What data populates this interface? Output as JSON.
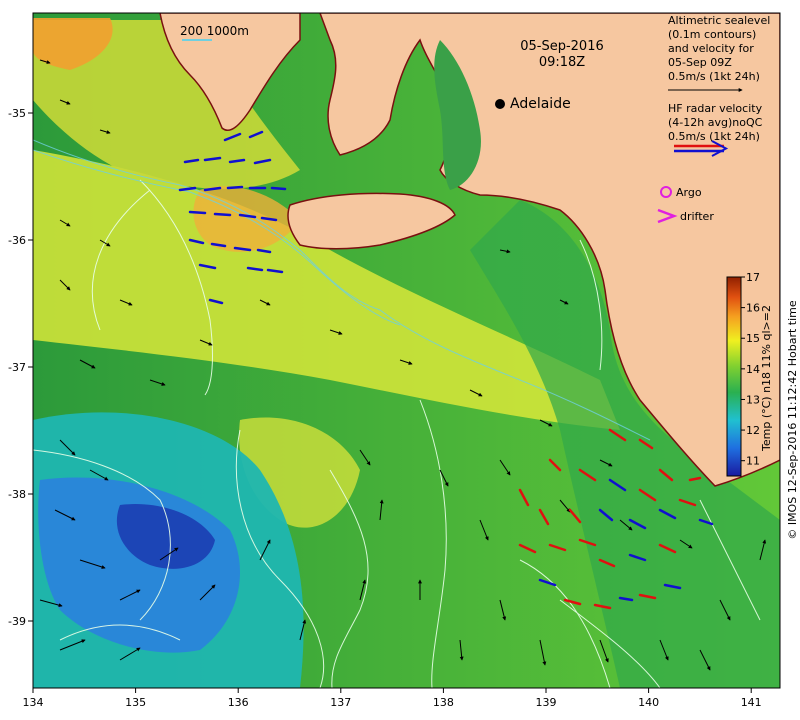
{
  "map": {
    "date": "05-Sep-2016",
    "time": "09:18Z",
    "place_label": "Adelaide",
    "bathymetry_label": "200  1000m",
    "x_ticks": [
      "134",
      "135",
      "136",
      "137",
      "138",
      "139",
      "140",
      "141"
    ],
    "y_ticks": [
      "-35",
      "-36",
      "-37",
      "-38",
      "-39"
    ],
    "altimetry_legend": [
      "Altimetric sealevel",
      "(0.1m contours)",
      "and velocity for",
      "05-Sep 09Z",
      "0.5m/s (1kt 24h)"
    ],
    "hf_legend": [
      "HF radar velocity",
      "(4-12h avg)noQC",
      "0.5m/s (1kt 24h)"
    ],
    "argo_label": "Argo",
    "drifter_label": "drifter",
    "colorbar_title": "Temp (°C) n18 11% ql>=2",
    "colorbar_ticks": [
      "17",
      "16",
      "15",
      "14",
      "13",
      "12",
      "11"
    ],
    "colorbar_range": [
      10.5,
      17
    ],
    "credit": "© IMOS 12-Sep-2016 11:12:42 Hobart time",
    "colors": {
      "land": "#f6c7a0",
      "coast": "#7a1010",
      "hf_blue": "#1010d0",
      "hf_red": "#e01010",
      "argo": "#e020e0",
      "contour": "#e8ffe8"
    }
  }
}
